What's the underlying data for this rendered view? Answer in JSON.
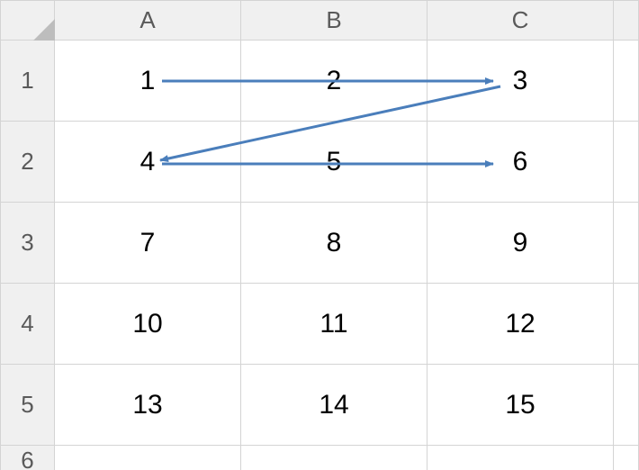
{
  "columns": [
    "A",
    "B",
    "C"
  ],
  "rows": [
    "1",
    "2",
    "3",
    "4",
    "5",
    "6"
  ],
  "cells": {
    "r1": {
      "c1": "1",
      "c2": "2",
      "c3": "3"
    },
    "r2": {
      "c1": "4",
      "c2": "5",
      "c3": "6"
    },
    "r3": {
      "c1": "7",
      "c2": "8",
      "c3": "9"
    },
    "r4": {
      "c1": "10",
      "c2": "11",
      "c3": "12"
    },
    "r5": {
      "c1": "13",
      "c2": "14",
      "c3": "15"
    }
  },
  "arrows": {
    "color": "#4a7ebb",
    "segments": [
      {
        "from": "A1",
        "to": "C1"
      },
      {
        "from": "C1",
        "to": "A2"
      },
      {
        "from": "A2",
        "to": "C2"
      }
    ]
  },
  "chart_data": {
    "type": "table",
    "columns": [
      "A",
      "B",
      "C"
    ],
    "data": [
      [
        1,
        2,
        3
      ],
      [
        4,
        5,
        6
      ],
      [
        7,
        8,
        9
      ],
      [
        10,
        11,
        12
      ],
      [
        13,
        14,
        15
      ]
    ],
    "annotations": [
      {
        "kind": "arrow",
        "from": "A1",
        "to": "C1"
      },
      {
        "kind": "arrow",
        "from": "C1",
        "to": "A2"
      },
      {
        "kind": "arrow",
        "from": "A2",
        "to": "C2"
      }
    ]
  }
}
